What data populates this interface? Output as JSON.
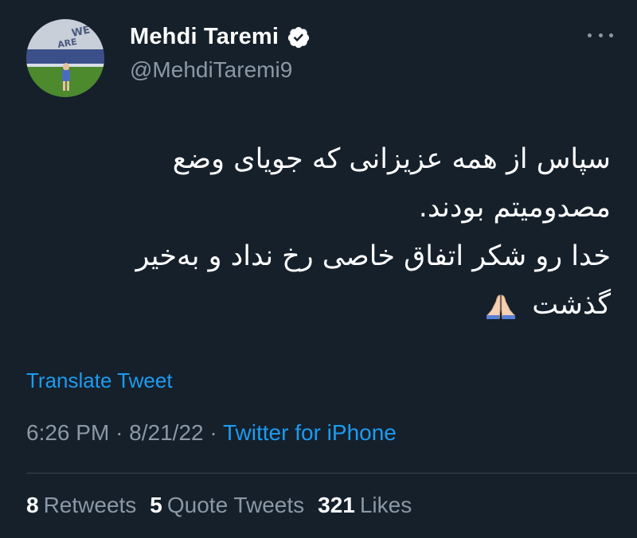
{
  "user": {
    "display_name": "Mehdi Taremi",
    "handle": "@MehdiTaremi9"
  },
  "tweet": {
    "lines": [
      "سپاس از همه عزیزانی که جویای وضع",
      "مصدومیتم بودند.",
      "خدا رو شکر اتفاق خاصی رخ نداد و به‌خیر",
      "گذشت"
    ],
    "emoji": "folded-hands"
  },
  "translate_label": "Translate Tweet",
  "meta": {
    "time": "6:26 PM",
    "separator": "·",
    "date": "8/21/22",
    "source": "Twitter for iPhone"
  },
  "stats": {
    "retweets_count": "8",
    "retweets_label": "Retweets",
    "quote_count": "5",
    "quote_label": "Quote Tweets",
    "likes_count": "321",
    "likes_label": "Likes"
  },
  "icons": {
    "verified": "verified-badge-icon",
    "more": "more-options-icon"
  },
  "colors": {
    "background": "#15202b",
    "accent": "#1d9bf0",
    "secondary_text": "#8b98a5",
    "divider": "#38444d"
  }
}
